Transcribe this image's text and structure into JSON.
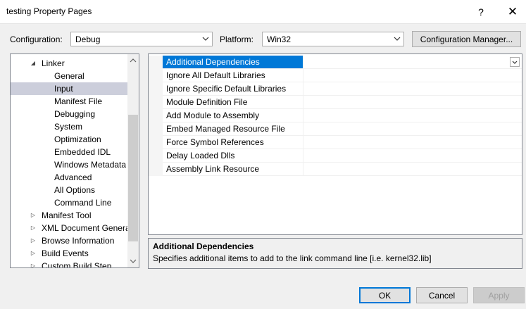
{
  "window": {
    "title": "testing Property Pages",
    "help_glyph": "?",
    "close_glyph": "✕"
  },
  "toolbar": {
    "configuration_label": "Configuration:",
    "configuration_value": "Debug",
    "platform_label": "Platform:",
    "platform_value": "Win32",
    "config_manager_label": "Configuration Manager..."
  },
  "tree": {
    "items": [
      {
        "label": "Linker",
        "level": 1,
        "expander": "expanded"
      },
      {
        "label": "General",
        "level": 2
      },
      {
        "label": "Input",
        "level": 2,
        "selected": true
      },
      {
        "label": "Manifest File",
        "level": 2
      },
      {
        "label": "Debugging",
        "level": 2
      },
      {
        "label": "System",
        "level": 2
      },
      {
        "label": "Optimization",
        "level": 2
      },
      {
        "label": "Embedded IDL",
        "level": 2
      },
      {
        "label": "Windows Metadata",
        "level": 2
      },
      {
        "label": "Advanced",
        "level": 2
      },
      {
        "label": "All Options",
        "level": 2
      },
      {
        "label": "Command Line",
        "level": 2
      },
      {
        "label": "Manifest Tool",
        "level": 1,
        "expander": "collapsed"
      },
      {
        "label": "XML Document Generator",
        "level": 1,
        "expander": "collapsed"
      },
      {
        "label": "Browse Information",
        "level": 1,
        "expander": "collapsed"
      },
      {
        "label": "Build Events",
        "level": 1,
        "expander": "collapsed"
      },
      {
        "label": "Custom Build Step",
        "level": 1,
        "expander": "collapsed"
      }
    ]
  },
  "grid": {
    "rows": [
      {
        "name": "Additional Dependencies",
        "value": "",
        "selected": true
      },
      {
        "name": "Ignore All Default Libraries",
        "value": ""
      },
      {
        "name": "Ignore Specific Default Libraries",
        "value": ""
      },
      {
        "name": "Module Definition File",
        "value": ""
      },
      {
        "name": "Add Module to Assembly",
        "value": ""
      },
      {
        "name": "Embed Managed Resource File",
        "value": ""
      },
      {
        "name": "Force Symbol References",
        "value": ""
      },
      {
        "name": "Delay Loaded Dlls",
        "value": ""
      },
      {
        "name": "Assembly Link Resource",
        "value": ""
      }
    ]
  },
  "description": {
    "title": "Additional Dependencies",
    "text": "Specifies additional items to add to the link command line [i.e. kernel32.lib]"
  },
  "buttons": {
    "ok": "OK",
    "cancel": "Cancel",
    "apply": "Apply"
  },
  "colors": {
    "selection": "#0078d7",
    "tree_selection": "#cccedb"
  }
}
